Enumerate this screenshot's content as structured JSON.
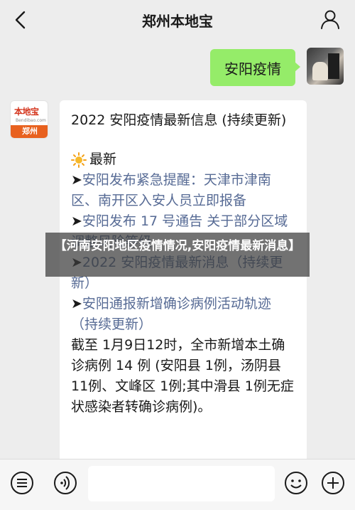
{
  "header": {
    "title": "郑州本地宝"
  },
  "chat": {
    "my_message": "安阳疫情",
    "bot_avatar": {
      "logo_text": "本地宝",
      "logo_sub": "Bendibao.com",
      "city": "郑州"
    },
    "bot_message": {
      "heading": "2022 安阳疫情最新信息 (持续更新)",
      "latest_label": "最新",
      "items": [
        {
          "arrow": "➤",
          "text": "安阳发布紧急提醒：天津市津南区、南开区入安人员立即报备"
        },
        {
          "arrow": "➤",
          "text": "安阳发布 17 号通告 关于部分区域调整风险等级"
        },
        {
          "arrow": "➤",
          "text": "2022 安阳疫情最新消息（持续更新）"
        },
        {
          "arrow": "➤",
          "text": "安阳通报新增确诊病例活动轨迹（持续更新）"
        }
      ],
      "detail": "截至 1月9日12时，全市新增本土确诊病例 14 例 (安阳县 1例，汤阴县 11例、文峰区 1例;其中滑县 1例无症状感染者转确诊病例)。"
    }
  },
  "overlay": {
    "text": "【河南安阳地区疫情情况,安阳疫情最新消息】"
  },
  "input_bar": {
    "placeholder": ""
  },
  "colors": {
    "my_bubble": "#95ec69",
    "link": "#576b95",
    "background": "#ededed"
  }
}
